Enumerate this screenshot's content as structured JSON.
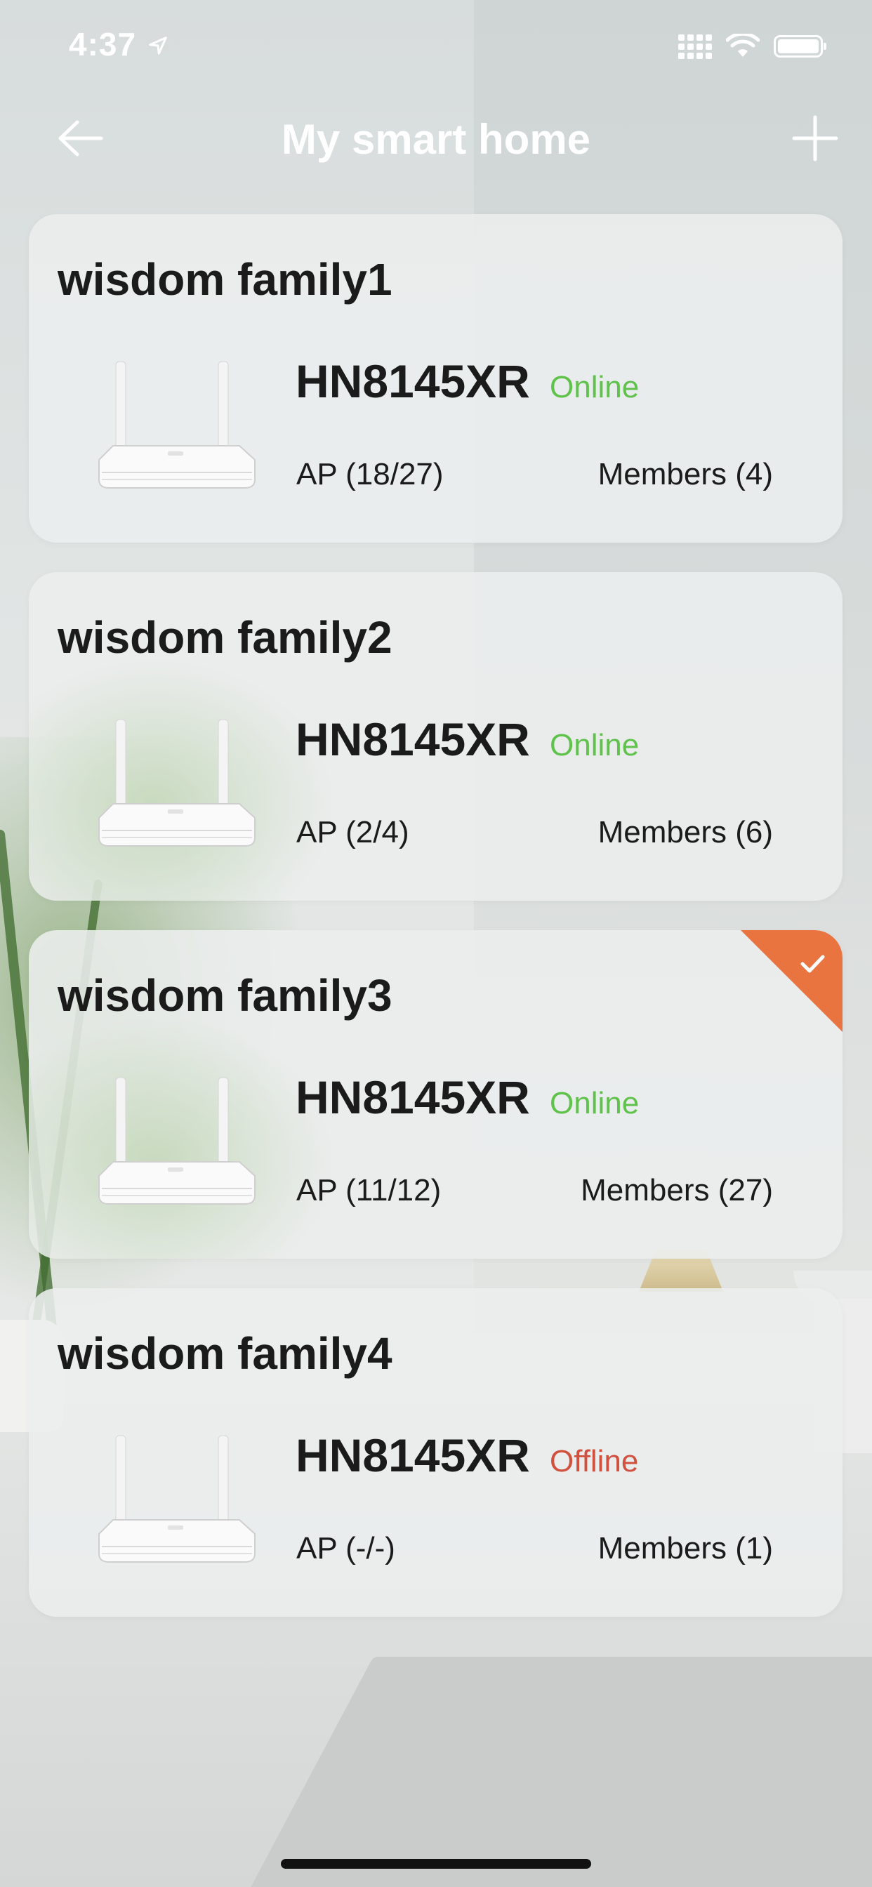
{
  "status_bar": {
    "time": "4:37"
  },
  "nav": {
    "title": "My smart home"
  },
  "colors": {
    "online": "#5fc24a",
    "offline": "#d0523e",
    "selected_tag": "#e9743f"
  },
  "families": [
    {
      "name": "wisdom family1",
      "model": "HN8145XR",
      "status": "Online",
      "ap": "AP (18/27)",
      "members": "Members (4)",
      "selected": false
    },
    {
      "name": "wisdom family2",
      "model": "HN8145XR",
      "status": "Online",
      "ap": "AP (2/4)",
      "members": "Members (6)",
      "selected": false
    },
    {
      "name": "wisdom family3",
      "model": "HN8145XR",
      "status": "Online",
      "ap": "AP (11/12)",
      "members": "Members (27)",
      "selected": true
    },
    {
      "name": "wisdom family4",
      "model": "HN8145XR",
      "status": "Offline",
      "ap": "AP (-/-)",
      "members": "Members (1)",
      "selected": false
    }
  ]
}
